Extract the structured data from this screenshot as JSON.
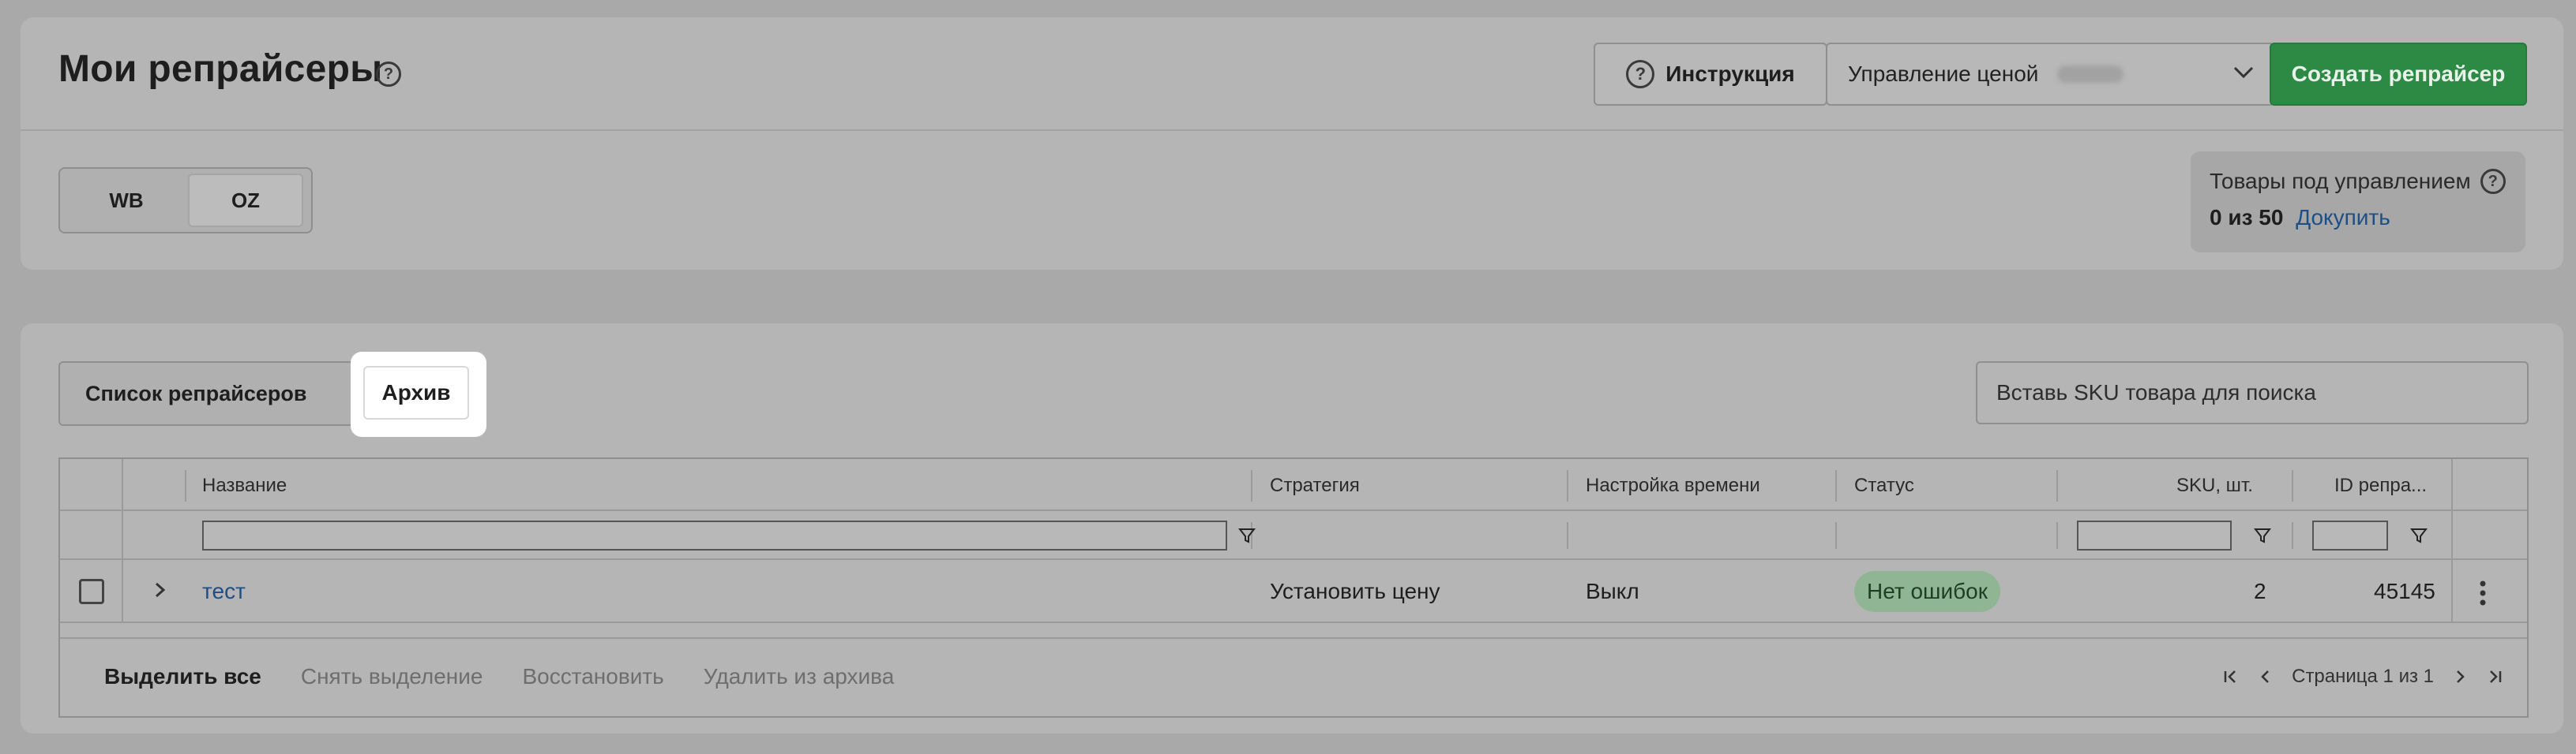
{
  "header": {
    "title": "Мои репрайсеры",
    "instruction_label": "Инструкция",
    "price_select_value": "Управление ценой",
    "create_label": "Создать репрайсер"
  },
  "marketplaces": [
    "WB",
    "OZ"
  ],
  "managed": {
    "label": "Товары под управлением",
    "count": "0 из 50",
    "buy_link": "Докупить"
  },
  "tabs": {
    "list_label": "Список репрайсеров",
    "archive_label": "Архив"
  },
  "search": {
    "placeholder": "Вставь SKU товара для поиска"
  },
  "table": {
    "columns": {
      "name": "Название",
      "strategy": "Стратегия",
      "time": "Настройка времени",
      "status": "Статус",
      "sku": "SKU, шт.",
      "id": "ID репра..."
    },
    "rows": [
      {
        "name": "тест",
        "strategy": "Установить цену",
        "time": "Выкл",
        "status": "Нет ошибок",
        "sku": "2",
        "id": "45145"
      }
    ]
  },
  "footer": {
    "select_all": "Выделить все",
    "deselect": "Снять выделение",
    "restore": "Восстановить",
    "delete_archive": "Удалить из архива",
    "page_info": "Страница 1 из 1"
  },
  "colors": {
    "primary_green": "#2d8a45",
    "link_blue": "#1d4e86",
    "status_badge": "#8fb595"
  }
}
